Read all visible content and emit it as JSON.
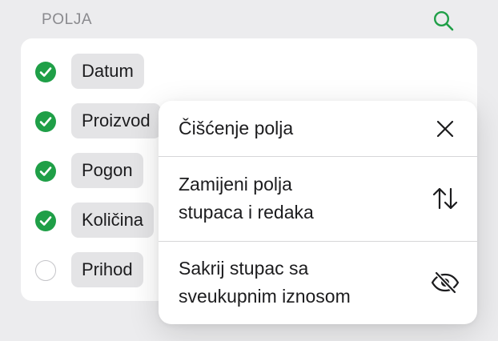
{
  "header": {
    "title": "POLJA",
    "search_icon": "search-icon"
  },
  "colors": {
    "accent": "#1f9f47",
    "chip_bg": "#e4e4e6",
    "background": "#ececee"
  },
  "fields": [
    {
      "label": "Datum",
      "checked": true
    },
    {
      "label": "Proizvod",
      "checked": true
    },
    {
      "label": "Pogon",
      "checked": true
    },
    {
      "label": "Količina",
      "checked": true
    },
    {
      "label": "Prihod",
      "checked": false
    }
  ],
  "menu": {
    "items": [
      {
        "label": "Čišćenje polja",
        "icon": "close-icon"
      },
      {
        "label": "Zamijeni polja\nstupaca i redaka",
        "icon": "swap-arrows-icon"
      },
      {
        "label": "Sakrij stupac sa\nsveukupnim iznosom",
        "icon": "eye-slash-icon"
      }
    ]
  }
}
